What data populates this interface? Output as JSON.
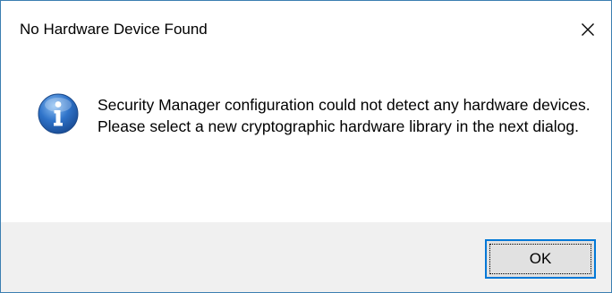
{
  "window": {
    "title": "No Hardware Device Found",
    "close_icon": "close-icon"
  },
  "message": {
    "icon": "info-icon",
    "lines": [
      "Security Manager configuration could not detect any hardware devices.",
      "Please select a new cryptographic hardware library in the next dialog."
    ]
  },
  "buttons": {
    "ok_label": "OK"
  },
  "colors": {
    "border": "#3c7fb1",
    "footer_bg": "#f0f0f0",
    "button_bg": "#e1e1e1",
    "button_focus_border": "#0078d7",
    "icon_blue": "#2a6fc4"
  }
}
